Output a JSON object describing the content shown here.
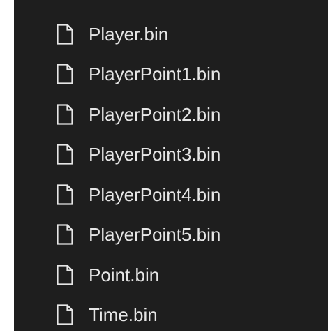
{
  "file_list": {
    "icon": "document-icon",
    "colors": {
      "background": "#1e1e1e",
      "text": "#e6e6e6",
      "icon_stroke": "#e6e6e6"
    },
    "items": [
      {
        "name": "Player.bin"
      },
      {
        "name": "PlayerPoint1.bin"
      },
      {
        "name": "PlayerPoint2.bin"
      },
      {
        "name": "PlayerPoint3.bin"
      },
      {
        "name": "PlayerPoint4.bin"
      },
      {
        "name": "PlayerPoint5.bin"
      },
      {
        "name": "Point.bin"
      },
      {
        "name": "Time.bin"
      }
    ]
  }
}
